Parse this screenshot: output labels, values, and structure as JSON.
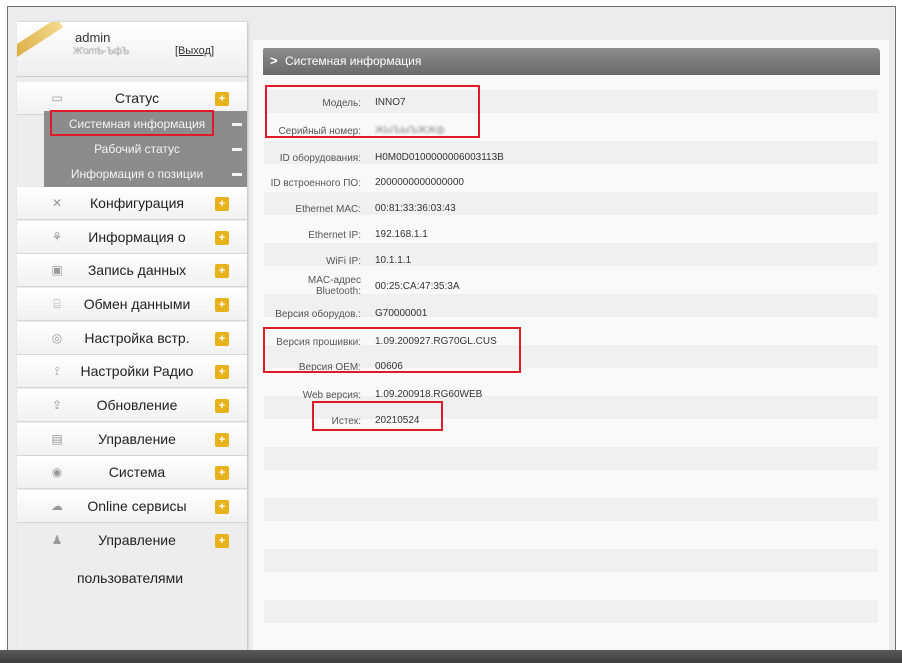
{
  "user": {
    "name": "admin",
    "sub_text": "Ж'олтЬ-ЪфЪ",
    "logout_label": "[Выход]"
  },
  "sidebar": {
    "items": [
      {
        "label": "Статус",
        "icon": "monitor-icon"
      },
      {
        "label": "Конфигурация",
        "icon": "wrench-icon"
      },
      {
        "label": "Информация о",
        "icon": "info-icon"
      },
      {
        "label": "Запись данных",
        "icon": "record-icon"
      },
      {
        "label": "Обмен данными",
        "icon": "exchange-icon"
      },
      {
        "label": "Настройка встр.",
        "icon": "settings-icon"
      },
      {
        "label": "Настройки Радио",
        "icon": "radio-icon"
      },
      {
        "label": "Обновление",
        "icon": "update-icon"
      },
      {
        "label": "Управление",
        "icon": "manage-icon"
      },
      {
        "label": "Система",
        "icon": "system-icon"
      },
      {
        "label": "Online сервисы",
        "icon": "cloud-icon"
      },
      {
        "label": "Управление",
        "icon": "users-icon"
      }
    ],
    "users_continuation": "пользователями",
    "status_subitems": [
      {
        "label": "Системная информация"
      },
      {
        "label": "Рабочий статус"
      },
      {
        "label": "Информация о позиции"
      }
    ],
    "plus_symbol": "+"
  },
  "panel": {
    "title": "Системная информация",
    "chevron": ">",
    "rows": [
      {
        "label": "Модель:",
        "value": "INNO7"
      },
      {
        "label": "Серийный номер:",
        "value": "ЖЫЪЫЪЖЖф"
      },
      {
        "label": "ID оборудования:",
        "value": "H0M0D0100000006003113B"
      },
      {
        "label": "ID встроенного ПО:",
        "value": "2000000000000000"
      },
      {
        "label": "Ethernet MAC:",
        "value": "00:81:33:36:03:43"
      },
      {
        "label": "Ethernet IP:",
        "value": "192.168.1.1"
      },
      {
        "label": "WiFi IP:",
        "value": "10.1.1.1"
      },
      {
        "label": "MAC-адрес Bluetooth:",
        "value": "00:25:CA:47:35:3A"
      },
      {
        "label": "Версия оборудов.:",
        "value": "G70000001"
      },
      {
        "label": "Версия прошивки:",
        "value": "1.09.200927.RG70GL.CUS"
      },
      {
        "label": "Версия OEM:",
        "value": "00606"
      },
      {
        "label": "Web версия:",
        "value": "1.09.200918.RG60WEB"
      },
      {
        "label": "Истек:",
        "value": "20210524"
      }
    ]
  },
  "colors": {
    "highlight_box": "#e11a2a",
    "plus_badge": "#e8b21c",
    "submenu_bg": "#8c8c8c",
    "header_bg": "#7a7a7a"
  }
}
